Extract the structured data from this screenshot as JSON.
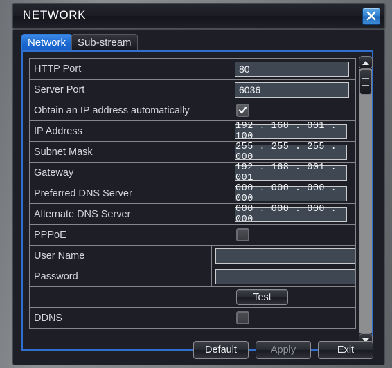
{
  "window": {
    "title": "NETWORK",
    "close_icon": "close-x-icon"
  },
  "tabs": [
    {
      "label": "Network",
      "active": true
    },
    {
      "label": "Sub-stream",
      "active": false
    }
  ],
  "settings_rows": [
    {
      "label": "HTTP Port",
      "type": "text",
      "value": "80"
    },
    {
      "label": "Server Port",
      "type": "text",
      "value": "6036"
    },
    {
      "label": "Obtain an IP address automatically",
      "type": "checkbox",
      "checked": true
    },
    {
      "label": "IP Address",
      "type": "ip",
      "value": "192 . 168 . 001 . 100"
    },
    {
      "label": "Subnet Mask",
      "type": "ip",
      "value": "255 . 255 . 255 . 000"
    },
    {
      "label": "Gateway",
      "type": "ip",
      "value": "192 . 168 . 001 . 001"
    },
    {
      "label": "Preferred DNS Server",
      "type": "ip",
      "value": "000 . 000 . 000 . 000"
    },
    {
      "label": "Alternate DNS Server",
      "type": "ip",
      "value": "000 . 000 . 000 . 000"
    },
    {
      "label": "PPPoE",
      "type": "checkbox",
      "checked": false
    },
    {
      "label": "User Name",
      "type": "text",
      "value": ""
    },
    {
      "label": "Password",
      "type": "text",
      "value": ""
    },
    {
      "label": "",
      "type": "button",
      "value": "Test"
    },
    {
      "label": "DDNS",
      "type": "checkbox",
      "checked": false
    }
  ],
  "scrollbar": {
    "up_icon": "chevron-up-icon",
    "down_icon": "chevron-down-icon"
  },
  "footer": {
    "default_label": "Default",
    "apply_label": "Apply",
    "exit_label": "Exit"
  },
  "colors": {
    "accent_blue": "#2f6fd0",
    "tab_active": "#1d6ad2",
    "panel_bg": "#1d1e26",
    "field_bg": "#3e4752",
    "border_gray": "#85878c"
  }
}
